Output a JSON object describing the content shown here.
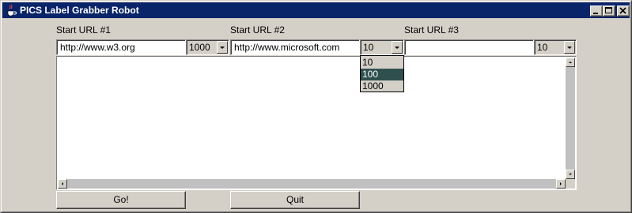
{
  "window": {
    "title": "PICS Label Grabber Robot",
    "colors": {
      "titlebar": "#0a246a",
      "face": "#d4d0c8",
      "selected": "#2f4f4f"
    }
  },
  "titlebar_buttons": [
    "minimize-icon",
    "maximize-icon",
    "close-icon"
  ],
  "url1": {
    "label": "Start URL #1",
    "value": "http://www.w3.org",
    "depth": "1000"
  },
  "url2": {
    "label": "Start URL #2",
    "value": "http://www.microsoft.com",
    "depth": "10"
  },
  "url3": {
    "label": "Start URL #3",
    "value": "",
    "depth": "10"
  },
  "dropdown": {
    "options": [
      "10",
      "100",
      "1000"
    ],
    "highlighted": "100"
  },
  "output": {
    "text": ""
  },
  "buttons": {
    "go": "Go!",
    "quit": "Quit"
  }
}
